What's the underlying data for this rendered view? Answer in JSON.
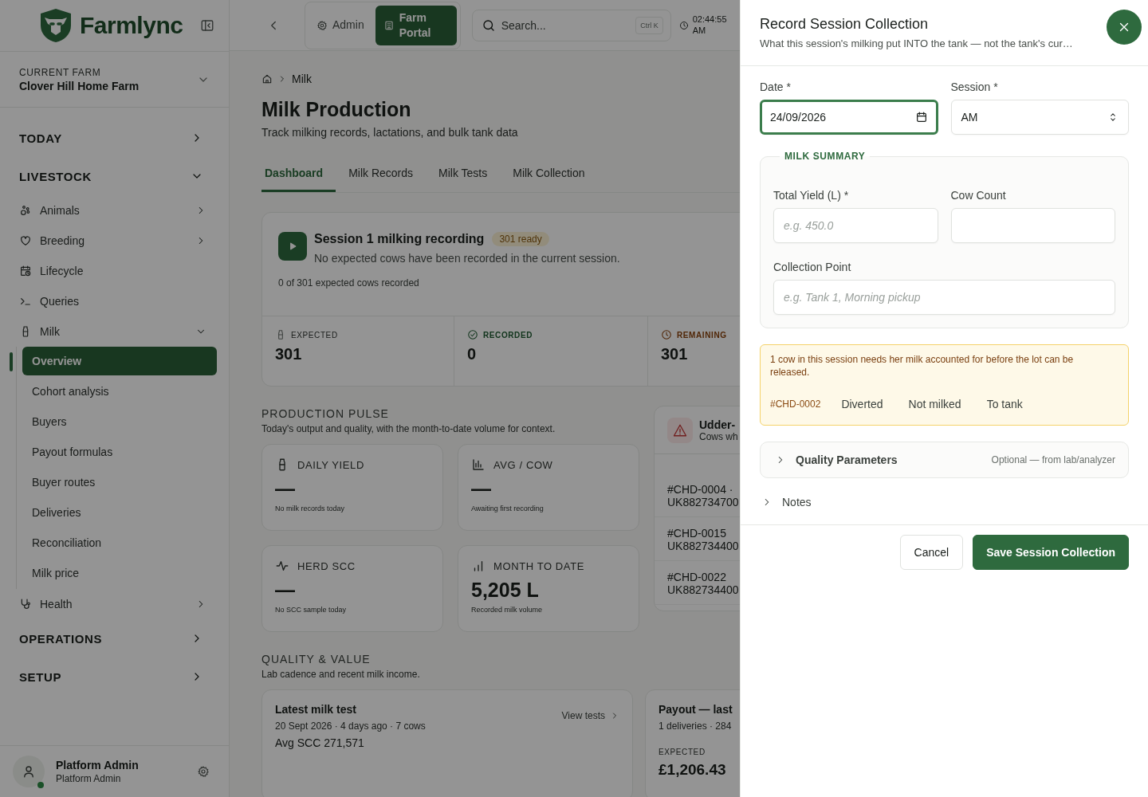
{
  "sidebar": {
    "brand": "Farmlync",
    "farm": {
      "label": "CURRENT FARM",
      "name": "Clover Hill Home Farm"
    },
    "sections": [
      {
        "label": "TODAY",
        "expanded": false
      },
      {
        "label": "LIVESTOCK",
        "expanded": true,
        "items": [
          {
            "label": "Animals",
            "kind": "group",
            "expanded": false
          },
          {
            "label": "Breeding",
            "kind": "group",
            "expanded": false
          },
          {
            "label": "Lifecycle",
            "kind": "link"
          },
          {
            "label": "Queries",
            "kind": "link"
          },
          {
            "label": "Milk",
            "kind": "group",
            "expanded": true,
            "children": [
              {
                "label": "Overview",
                "selected": true
              },
              {
                "label": "Cohort analysis",
                "selected": false
              },
              {
                "label": "Buyers",
                "selected": false
              },
              {
                "label": "Payout formulas",
                "selected": false
              },
              {
                "label": "Buyer routes",
                "selected": false
              },
              {
                "label": "Deliveries",
                "selected": false
              },
              {
                "label": "Reconciliation",
                "selected": false
              },
              {
                "label": "Milk price",
                "selected": false
              }
            ]
          },
          {
            "label": "Health",
            "kind": "group",
            "expanded": false
          }
        ]
      },
      {
        "label": "OPERATIONS",
        "expanded": false
      },
      {
        "label": "SETUP",
        "expanded": false
      }
    ],
    "user": {
      "name": "Platform Admin",
      "role": "Platform Admin",
      "online": true
    }
  },
  "topbar": {
    "portals": [
      {
        "label": "Admin",
        "selected": false
      },
      {
        "label": "Farm Portal",
        "selected": true
      }
    ],
    "search": {
      "placeholder": "Search...",
      "shortcut": "Ctrl K"
    },
    "time": "02:44:55 AM"
  },
  "page": {
    "breadcrumb": [
      "Milk"
    ],
    "title": "Milk Production",
    "subtitle": "Track milking records, lactations, and bulk tank data",
    "tabs": [
      {
        "label": "Dashboard",
        "selected": true
      },
      {
        "label": "Milk Records",
        "selected": false
      },
      {
        "label": "Milk Tests",
        "selected": false
      },
      {
        "label": "Milk Collection",
        "selected": false
      }
    ]
  },
  "session": {
    "title": "Session 1 milking recording",
    "badge": "301 ready",
    "description": "No expected cows have been recorded in the current session.",
    "progress": "0 of 301 expected cows recorded",
    "stats": [
      {
        "kind": "expected",
        "label": "EXPECTED",
        "value": "301"
      },
      {
        "kind": "recorded",
        "label": "RECORDED",
        "value": "0"
      },
      {
        "kind": "remaining",
        "label": "REMAINING",
        "value": "301"
      }
    ]
  },
  "production_pulse": {
    "heading": "PRODUCTION PULSE",
    "subtitle": "Today's output and quality, with the month-to-date volume for context.",
    "metrics": [
      {
        "label": "DAILY YIELD",
        "value": "—",
        "note": "No milk records today"
      },
      {
        "label": "AVG / COW",
        "value": "—",
        "note": "Awaiting first recording"
      },
      {
        "label": "HERD SCC",
        "value": "—",
        "note": "No SCC sample today"
      },
      {
        "label": "MONTH TO DATE",
        "value": "5,205 L",
        "note": "Recorded milk volume"
      }
    ],
    "alert_card": {
      "title": "Udder-",
      "subtitle": "Cows wh",
      "cows": [
        {
          "id": "#CHD-0004 ·",
          "tag": "UK882734700"
        },
        {
          "id": "#CHD-0015",
          "tag": "UK882734400"
        },
        {
          "id": "#CHD-0022",
          "tag": "UK882734400"
        }
      ]
    }
  },
  "quality_value": {
    "heading": "QUALITY & VALUE",
    "subtitle": "Lab cadence and recent milk income.",
    "milk_test": {
      "title": "Latest milk test",
      "meta": "20 Sept 2026 · 4 days ago · 7 cows",
      "summary": "Avg SCC 271,571",
      "link": "View tests"
    },
    "payout": {
      "title": "Payout — last",
      "meta": "1 deliveries · 284",
      "label": "EXPECTED",
      "amount": "£1,206.43"
    }
  },
  "drawer": {
    "title": "Record Session Collection",
    "subtitle": "What this session's milking put INTO the tank — not the tank's cur…",
    "date": {
      "label": "Date *",
      "value": "24/09/2026",
      "focused": true
    },
    "session": {
      "label": "Session *",
      "value": "AM"
    },
    "summary": {
      "legend": "MILK SUMMARY",
      "total_yield": {
        "label": "Total Yield (L) *",
        "placeholder": "e.g. 450.0"
      },
      "cow_count": {
        "label": "Cow Count"
      },
      "collection_point": {
        "label": "Collection Point",
        "placeholder": "e.g. Tank 1, Morning pickup"
      }
    },
    "warning": {
      "message": "1 cow in this session needs her milk accounted for before the lot can be released.",
      "cow": "#CHD-0002",
      "options": [
        {
          "label": "Diverted",
          "selected": false
        },
        {
          "label": "Not milked",
          "selected": false
        },
        {
          "label": "To tank",
          "selected": false
        }
      ]
    },
    "quality": {
      "label": "Quality Parameters",
      "hint": "Optional — from lab/analyzer",
      "expanded": false
    },
    "notes": {
      "label": "Notes",
      "expanded": false
    },
    "buttons": {
      "cancel": "Cancel",
      "save": "Save Session Collection"
    }
  }
}
